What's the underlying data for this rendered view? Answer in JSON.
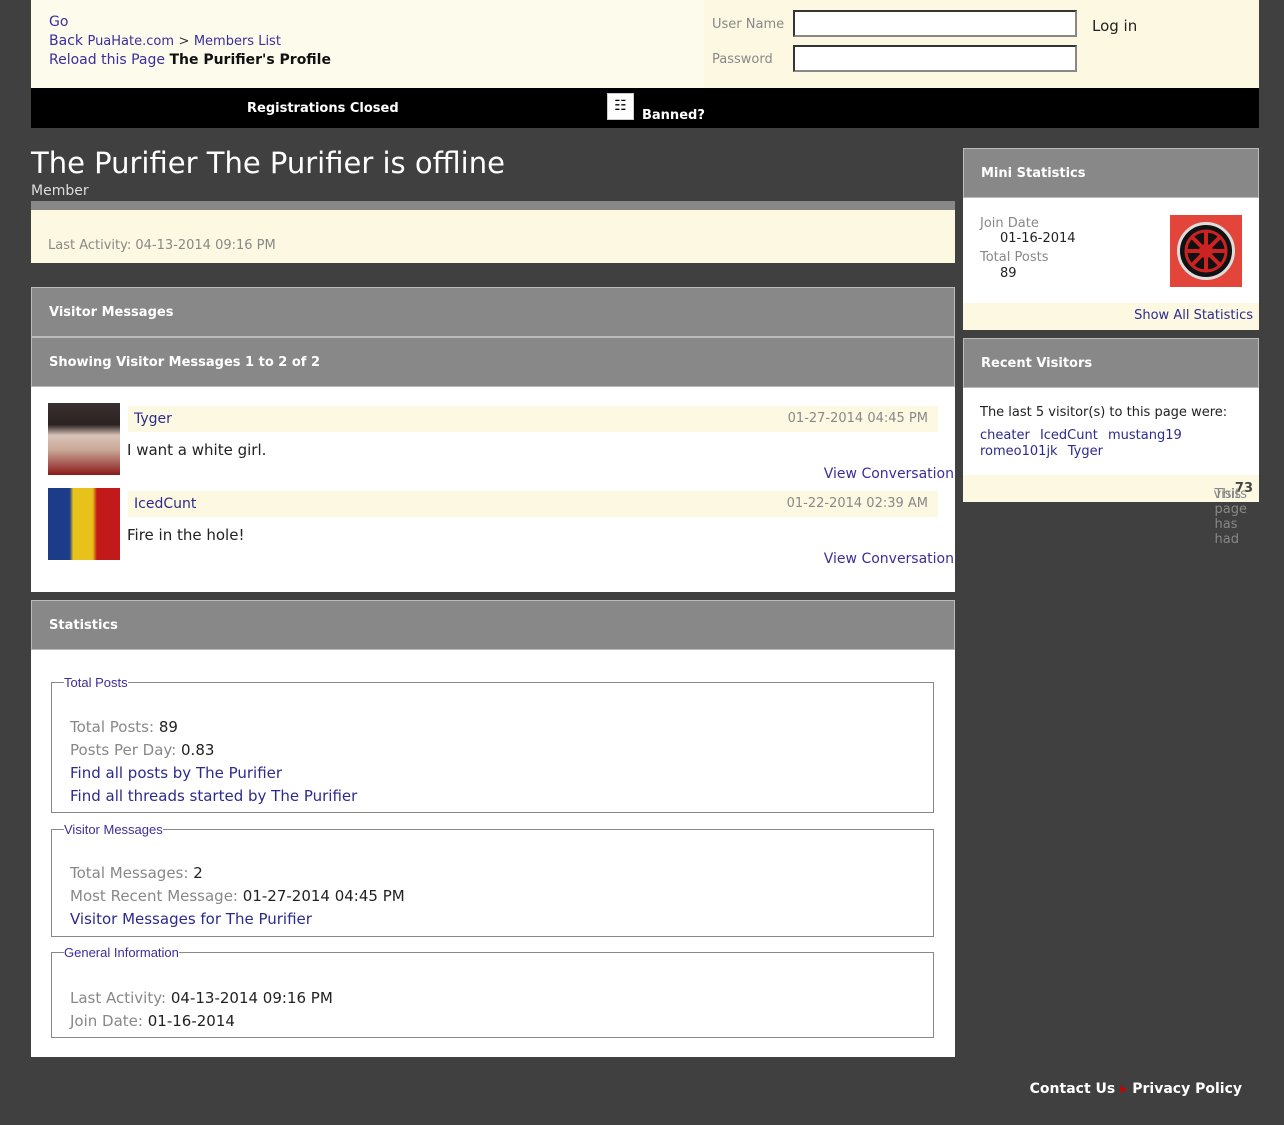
{
  "header": {
    "go": "Go",
    "back": "Back",
    "site": "PuaHate.com",
    "sep": ">",
    "members": "Members List",
    "reload": "Reload this Page",
    "page_title": "The Purifier's Profile"
  },
  "login": {
    "username_label": "User Name",
    "password_label": "Password",
    "button": "Log in"
  },
  "navbar": {
    "registrations": "Registrations Closed",
    "banned": "Banned?",
    "icon": "ban-icon"
  },
  "profile": {
    "name": "The Purifier The Purifier is offline",
    "rank": "Member",
    "last_activity": "Last Activity: 04-13-2014 09:16 PM"
  },
  "visitor_messages": {
    "title": "Visitor Messages",
    "showing": "Showing Visitor Messages 1 to 2 of 2",
    "messages": [
      {
        "user": "Tyger",
        "date": "01-27-2014 04:45 PM",
        "text": "I want a white girl.",
        "link": "View Conversation"
      },
      {
        "user": "IcedCunt",
        "date": "01-22-2014 02:39 AM",
        "text": "Fire in the hole!",
        "link": "View Conversation"
      }
    ]
  },
  "statistics": {
    "title": "Statistics",
    "total_posts": {
      "legend": "Total Posts",
      "k1": "Total Posts:",
      "v1": "89",
      "k2": "Posts Per Day:",
      "v2": "0.83",
      "link1": "Find all posts by The Purifier",
      "link2": "Find all threads started by The Purifier"
    },
    "visitor": {
      "legend": "Visitor Messages",
      "k1": "Total Messages:",
      "v1": "2",
      "k2": "Most Recent Message:",
      "v2": "01-27-2014 04:45 PM",
      "link1": "Visitor Messages for The Purifier"
    },
    "general": {
      "legend": "General Information",
      "k1": "Last Activity:",
      "v1": "04-13-2014 09:16 PM",
      "k2": "Join Date:",
      "v2": "01-16-2014"
    }
  },
  "mini_stats": {
    "title": "Mini Statistics",
    "join_label": "Join Date",
    "join_value": "01-16-2014",
    "posts_label": "Total Posts",
    "posts_value": "89",
    "show_all": "Show All Statistics"
  },
  "recent_visitors": {
    "title": "Recent Visitors",
    "intro": "The last 5 visitor(s) to this page were:",
    "names": [
      "cheater",
      "IcedCunt",
      "mustang19",
      "romeo101jk",
      "Tyger"
    ],
    "visits_pre": "This page has had",
    "visits": "73",
    "visits_post": "visits"
  },
  "footer": {
    "contact": "Contact Us",
    "privacy": "Privacy Policy"
  }
}
